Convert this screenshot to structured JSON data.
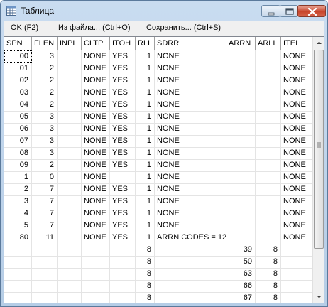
{
  "window": {
    "title": "Таблица"
  },
  "menu": [
    {
      "label": "OK (F2)"
    },
    {
      "label": "Из файла... (Ctrl+O)"
    },
    {
      "label": "Сохранить... (Ctrl+S)"
    }
  ],
  "table": {
    "columns": [
      "SPN",
      "FLEN",
      "INPL",
      "CLTP",
      "ITOH",
      "RLI",
      "SDRR",
      "ARRN",
      "ARLI",
      "ITEI"
    ],
    "rows": [
      [
        "00",
        "3",
        "",
        "NONE",
        "YES",
        "1",
        "NONE",
        "",
        "",
        "NONE"
      ],
      [
        "01",
        "2",
        "",
        "NONE",
        "YES",
        "1",
        "NONE",
        "",
        "",
        "NONE"
      ],
      [
        "02",
        "2",
        "",
        "NONE",
        "YES",
        "1",
        "NONE",
        "",
        "",
        "NONE"
      ],
      [
        "03",
        "2",
        "",
        "NONE",
        "YES",
        "1",
        "NONE",
        "",
        "",
        "NONE"
      ],
      [
        "04",
        "2",
        "",
        "NONE",
        "YES",
        "1",
        "NONE",
        "",
        "",
        "NONE"
      ],
      [
        "05",
        "3",
        "",
        "NONE",
        "YES",
        "1",
        "NONE",
        "",
        "",
        "NONE"
      ],
      [
        "06",
        "3",
        "",
        "NONE",
        "YES",
        "1",
        "NONE",
        "",
        "",
        "NONE"
      ],
      [
        "07",
        "3",
        "",
        "NONE",
        "YES",
        "1",
        "NONE",
        "",
        "",
        "NONE"
      ],
      [
        "08",
        "3",
        "",
        "NONE",
        "YES",
        "1",
        "NONE",
        "",
        "",
        "NONE"
      ],
      [
        "09",
        "2",
        "",
        "NONE",
        "YES",
        "1",
        "NONE",
        "",
        "",
        "NONE"
      ],
      [
        "1",
        "0",
        "",
        "NONE",
        "",
        "1",
        "NONE",
        "",
        "",
        "NONE"
      ],
      [
        "2",
        "7",
        "",
        "NONE",
        "YES",
        "1",
        "NONE",
        "",
        "",
        "NONE"
      ],
      [
        "3",
        "7",
        "",
        "NONE",
        "YES",
        "1",
        "NONE",
        "",
        "",
        "NONE"
      ],
      [
        "4",
        "7",
        "",
        "NONE",
        "YES",
        "1",
        "NONE",
        "",
        "",
        "NONE"
      ],
      [
        "5",
        "7",
        "",
        "NONE",
        "YES",
        "1",
        "NONE",
        "",
        "",
        "NONE"
      ],
      [
        "80",
        "11",
        "",
        "NONE",
        "YES",
        "1",
        "ARRN CODES = 12",
        "",
        "",
        "NONE"
      ],
      [
        "",
        "",
        "",
        "",
        "",
        "8",
        "",
        "39",
        "8",
        ""
      ],
      [
        "",
        "",
        "",
        "",
        "",
        "8",
        "",
        "50",
        "8",
        ""
      ],
      [
        "",
        "",
        "",
        "",
        "",
        "8",
        "",
        "63",
        "8",
        ""
      ],
      [
        "",
        "",
        "",
        "",
        "",
        "8",
        "",
        "66",
        "8",
        ""
      ],
      [
        "",
        "",
        "",
        "",
        "",
        "8",
        "",
        "67",
        "8",
        ""
      ]
    ]
  },
  "icons": {
    "app": "table-icon",
    "minimize": "minimize-icon",
    "maximize": "maximize-icon",
    "close": "close-icon",
    "scroll_up": "arrow-up-icon",
    "scroll_down": "arrow-down-icon",
    "thumb_grip": "grip-icon"
  },
  "colors": {
    "close_button": "#c7452c",
    "titlebar": "#c9dcf0"
  }
}
